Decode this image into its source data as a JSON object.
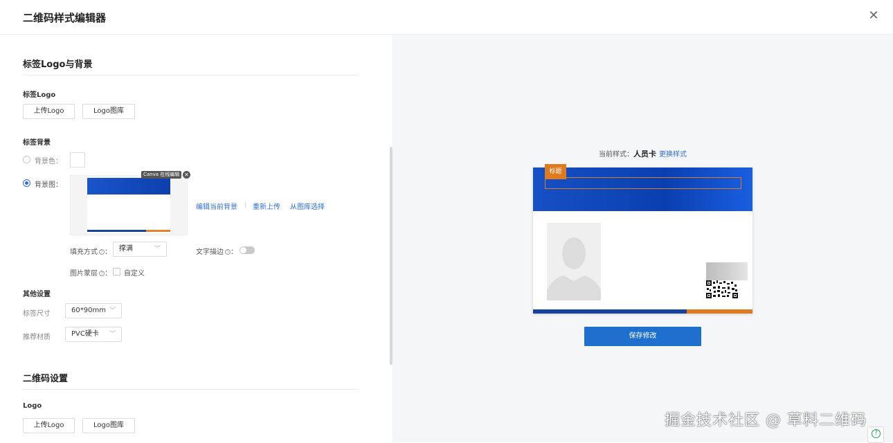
{
  "dialog": {
    "title": "二维码样式编辑器"
  },
  "left": {
    "section_logo_bg": "标签Logo与背景",
    "logo": {
      "title": "标签Logo",
      "upload": "上传Logo",
      "gallery": "Logo图库"
    },
    "background": {
      "title": "标签背景",
      "color_label": "背景色：",
      "image_label": "背景图：",
      "selected": "image",
      "canva_tag": "Canva 在线编辑",
      "edit_link": "编辑当前背景",
      "reupload_link": "重新上传",
      "gallery_link": "从图库选择",
      "fill_label": "填充方式",
      "fill_value": "撑满",
      "text_stroke_label": "文字描边",
      "text_stroke_on": false,
      "mask_label": "图片蒙层",
      "mask_option": "自定义"
    },
    "other": {
      "title": "其他设置",
      "size_label": "标签尺寸",
      "size_value": "60*90mm",
      "material_label": "推荐材质",
      "material_value": "PVC硬卡"
    },
    "section_qr": "二维码设置",
    "qr_logo": {
      "title": "Logo",
      "upload": "上传Logo",
      "gallery": "Logo图库"
    }
  },
  "right": {
    "current_style_label": "当前样式：",
    "current_style_value": "人员卡",
    "change_style": "更换样式",
    "card": {
      "tag": "标题"
    },
    "save_button": "保存修改",
    "help_label": "?"
  },
  "watermark": "掘金技术社区 @ 草料二维码",
  "colors": {
    "accent_blue": "#1f6fcf",
    "card_orange": "#e07a1f",
    "card_blue": "#0a3fb0"
  }
}
